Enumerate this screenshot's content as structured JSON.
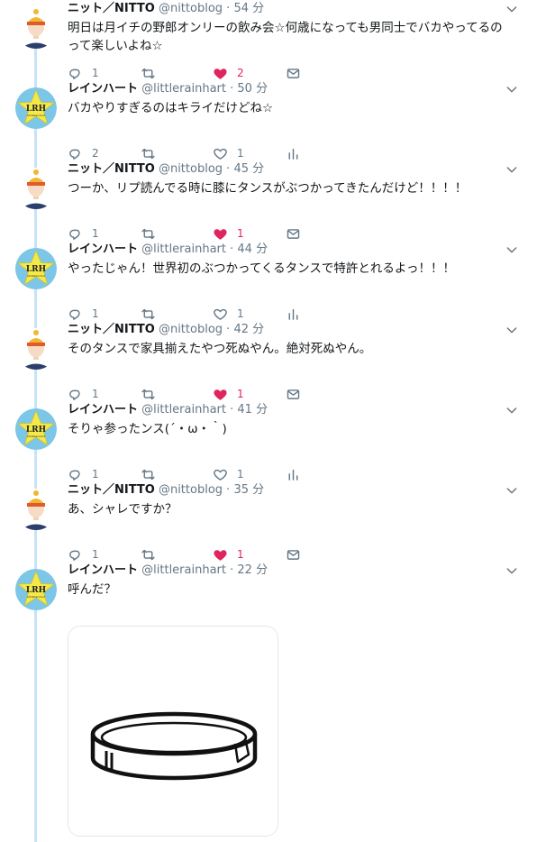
{
  "tweets": [
    {
      "author": "nitto",
      "name": "ニット／NITTO",
      "handle": "@nittoblog",
      "time": "54 分",
      "text": "明日は月イチの野郎オンリーの飲み会☆何歳になっても男同士でバカやってるのって楽しいよね☆",
      "replies": "1",
      "retweets": "",
      "likes": "2",
      "liked": true,
      "extra": "mail"
    },
    {
      "author": "rainhart",
      "name": "レインハート",
      "handle": "@littlerainhart",
      "time": "50 分",
      "text": "バカやりすぎるのはキライだけどね☆",
      "replies": "2",
      "retweets": "",
      "likes": "1",
      "liked": false,
      "extra": "stats"
    },
    {
      "author": "nitto",
      "name": "ニット／NITTO",
      "handle": "@nittoblog",
      "time": "45 分",
      "text": "つーか、リプ読んでる時に膝にタンスがぶつかってきたんだけど！！！！",
      "replies": "1",
      "retweets": "",
      "likes": "1",
      "liked": true,
      "extra": "mail"
    },
    {
      "author": "rainhart",
      "name": "レインハート",
      "handle": "@littlerainhart",
      "time": "44 分",
      "text": "やったじゃん！世界初のぶつかってくるタンスで特許とれるよっ！！！",
      "replies": "1",
      "retweets": "",
      "likes": "1",
      "liked": false,
      "extra": "stats"
    },
    {
      "author": "nitto",
      "name": "ニット／NITTO",
      "handle": "@nittoblog",
      "time": "42 分",
      "text": "そのタンスで家具揃えたやつ死ぬやん。絶対死ぬやん。",
      "replies": "1",
      "retweets": "",
      "likes": "1",
      "liked": true,
      "extra": "mail"
    },
    {
      "author": "rainhart",
      "name": "レインハート",
      "handle": "@littlerainhart",
      "time": "41 分",
      "text": "そりゃ参ったンス(´・ω・｀)",
      "replies": "1",
      "retweets": "",
      "likes": "1",
      "liked": false,
      "extra": "stats"
    },
    {
      "author": "nitto",
      "name": "ニット／NITTO",
      "handle": "@nittoblog",
      "time": "35 分",
      "text": "あ、シャレですか？",
      "replies": "1",
      "retweets": "",
      "likes": "1",
      "liked": true,
      "extra": "mail"
    },
    {
      "author": "rainhart",
      "name": "レインハート",
      "handle": "@littlerainhart",
      "time": "22 分",
      "text": "呼んだ？",
      "has_media": true
    }
  ],
  "avatar_rainhart_text": "LRH",
  "avatar_rainhart_sub": "LittleRainhart",
  "colors": {
    "thread_line": "#c6e4f6",
    "like_active": "#e0245e",
    "icon_gray": "#657786",
    "name": "#14171a"
  }
}
